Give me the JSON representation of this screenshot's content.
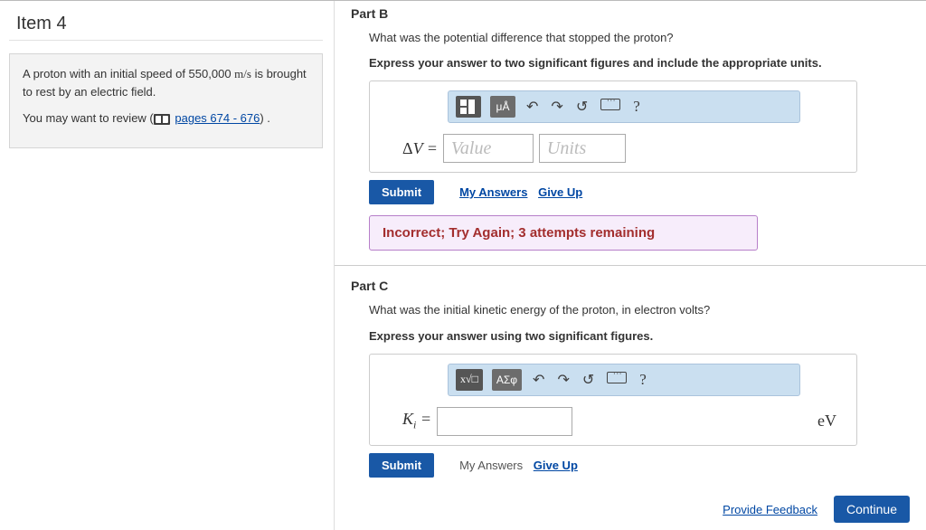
{
  "left": {
    "item_title": "Item 4",
    "problem_text_1": "A proton with an initial speed of 550,000 m/s is brought to rest by an electric field.",
    "review_prefix": "You may want to review (",
    "review_link": "pages 674 - 676",
    "review_suffix": ") ."
  },
  "partB": {
    "heading": "Part B",
    "question": "What was the potential difference that stopped the proton?",
    "instruction": "Express your answer to two significant figures and include the appropriate units.",
    "toolbar": {
      "units_tool": "μÅ",
      "help": "?"
    },
    "variable": "ΔV =",
    "value_placeholder": "Value",
    "units_placeholder": "Units",
    "submit": "Submit",
    "my_answers": "My Answers",
    "give_up": "Give Up",
    "feedback": "Incorrect; Try Again; 3 attempts remaining"
  },
  "partC": {
    "heading": "Part C",
    "question": "What was the initial kinetic energy of the proton, in electron volts?",
    "instruction": "Express your answer using two significant figures.",
    "toolbar": {
      "greek_tool": "ΑΣφ",
      "help": "?"
    },
    "variable": "Kᵢ =",
    "unit_suffix": "eV",
    "submit": "Submit",
    "my_answers": "My Answers",
    "give_up": "Give Up"
  },
  "footer": {
    "provide_feedback": "Provide Feedback",
    "continue": "Continue"
  }
}
